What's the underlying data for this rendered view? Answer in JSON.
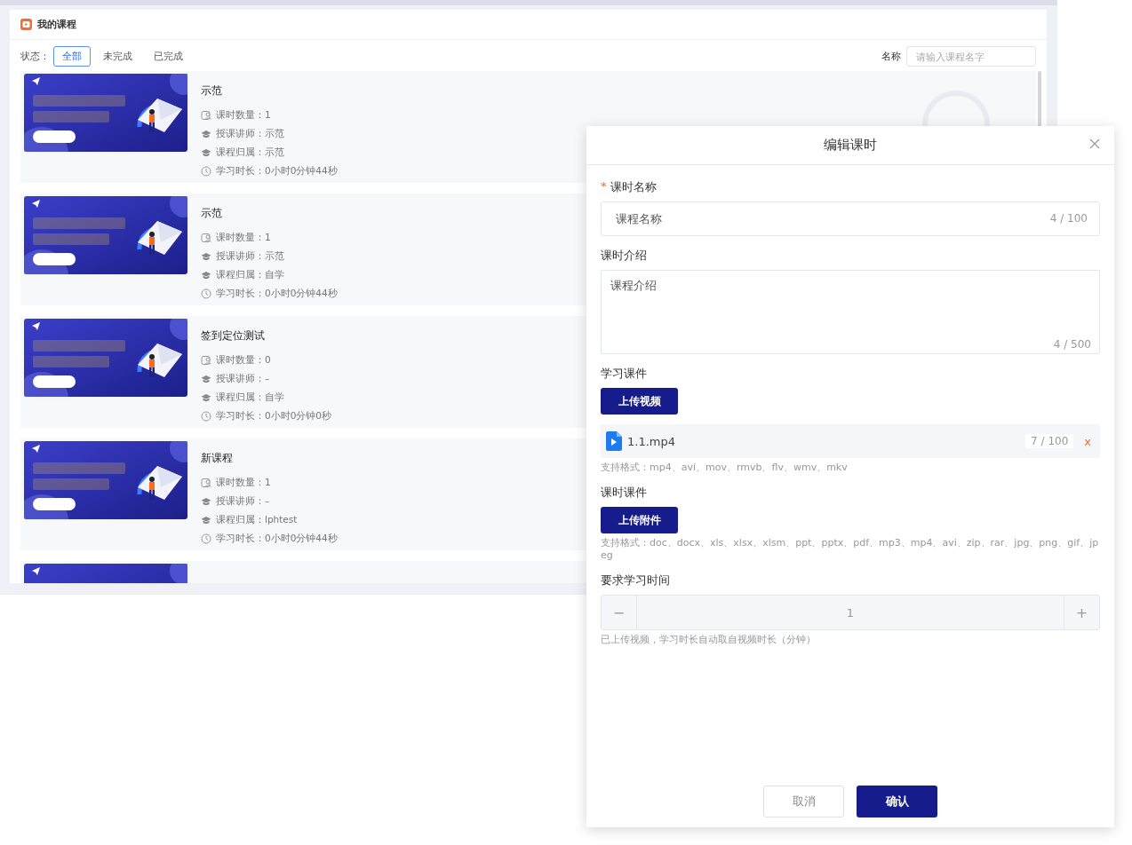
{
  "page_title": "我的课程",
  "status_filter": {
    "label": "状态：",
    "tabs": [
      {
        "label": "全部",
        "selected": true
      },
      {
        "label": "未完成",
        "selected": false
      },
      {
        "label": "已完成",
        "selected": false
      }
    ]
  },
  "search": {
    "label": "名称",
    "placeholder": "请输入课程名字"
  },
  "courses": [
    {
      "title": "示范",
      "cover": {
        "kind": "picture"
      },
      "progress_ring": true,
      "details": [
        {
          "kind": "lessons",
          "text": "课时数量：1"
        },
        {
          "kind": "teacher",
          "text": "授课讲师：示范"
        },
        {
          "kind": "owner",
          "text": "课程归属：示范"
        },
        {
          "kind": "duration",
          "text": "学习时长：0小时0分钟44秒"
        }
      ]
    },
    {
      "title": "示范",
      "cover": {
        "kind": "picture"
      },
      "details": [
        {
          "kind": "lessons",
          "text": "课时数量：1"
        },
        {
          "kind": "teacher",
          "text": "授课讲师：示范"
        },
        {
          "kind": "owner",
          "text": "课程归属：自学"
        },
        {
          "kind": "duration",
          "text": "学习时长：0小时0分钟44秒"
        }
      ]
    },
    {
      "title": "签到定位测试",
      "cover": {
        "kind": "picture"
      },
      "details": [
        {
          "kind": "lessons",
          "text": "课时数量：0"
        },
        {
          "kind": "teacher",
          "text": "授课讲师：–"
        },
        {
          "kind": "owner",
          "text": "课程归属：自学"
        },
        {
          "kind": "duration",
          "text": "学习时长：0小时0分钟0秒"
        }
      ]
    },
    {
      "title": "新课程",
      "cover": {
        "kind": "picture"
      },
      "details": [
        {
          "kind": "lessons",
          "text": "课时数量：1"
        },
        {
          "kind": "teacher",
          "text": "授课讲师：–"
        },
        {
          "kind": "owner",
          "text": "课程归属：lphtest"
        },
        {
          "kind": "duration",
          "text": "学习时长：0小时0分钟44秒"
        }
      ]
    },
    {
      "cover": {
        "kind": "picture"
      }
    }
  ],
  "dialog": {
    "title": "编辑课时",
    "fields": [
      {
        "kind": "input",
        "required_mark": "*",
        "label": "课时名称",
        "value": "课程名称",
        "counter": "4 / 100"
      },
      {
        "kind": "textarea",
        "label": "课时介绍",
        "value": "课程介绍",
        "counter": "4 / 500"
      },
      {
        "kind": "upload",
        "label": "学习课件",
        "button": "上传视频",
        "files": [
          {
            "name": "1.1.mp4",
            "counter": "7 / 100",
            "remove": "x"
          }
        ],
        "hint": "支持格式：mp4、avi、mov、rmvb、flv、wmv、mkv"
      },
      {
        "kind": "upload",
        "label": "课时课件",
        "button": "上传附件",
        "hint": "支持格式：doc、docx、xls、xlsx、xlsm、ppt、pptx、pdf、mp3、mp4、avi、zip、rar、jpg、png、gif、jpeg"
      },
      {
        "kind": "number",
        "label": "要求学习时间",
        "value": "1",
        "disabled": true,
        "decrement": "−",
        "increment": "+",
        "hint": "已上传视频，学习时长自动取自视频时长（分钟）"
      }
    ],
    "buttons": [
      {
        "kind": "secondary",
        "label": "取消"
      },
      {
        "kind": "primary",
        "label": "确认"
      }
    ]
  }
}
